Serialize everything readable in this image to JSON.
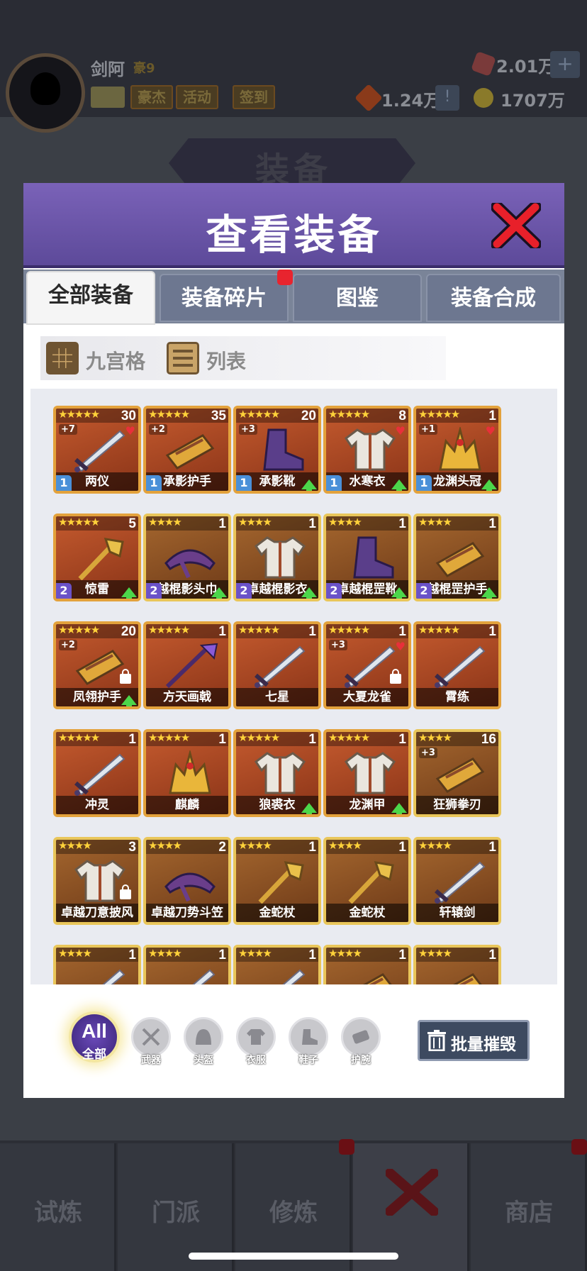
{
  "header": {
    "player_name": "剑阿",
    "player_rank": "豪9",
    "tags": [
      "豪杰",
      "活动",
      "签到"
    ],
    "currency_gems": "2.01万",
    "currency_tokens": "1.24万",
    "currency_coins": "1707万",
    "plus_label": "+",
    "excl_label": "!"
  },
  "page_title": "装备",
  "modal": {
    "title": "查看装备",
    "tabs": [
      "全部装备",
      "装备碎片",
      "图鉴",
      "装备合成"
    ],
    "view_grid_label": "九宫格",
    "view_list_label": "列表"
  },
  "items": [
    {
      "name": "两仪",
      "stars": 5,
      "count": "30",
      "plus": "+7",
      "heart": true,
      "tier": "1",
      "up": false,
      "lock": false,
      "art": "sword"
    },
    {
      "name": "承影护手",
      "stars": 5,
      "count": "35",
      "plus": "+2",
      "heart": false,
      "tier": "1",
      "up": false,
      "lock": false,
      "art": "bracer"
    },
    {
      "name": "承影靴",
      "stars": 5,
      "count": "20",
      "plus": "+3",
      "heart": false,
      "tier": "1",
      "up": true,
      "lock": false,
      "art": "boot"
    },
    {
      "name": "水寒衣",
      "stars": 5,
      "count": "8",
      "plus": "",
      "heart": true,
      "tier": "1",
      "up": true,
      "lock": false,
      "art": "armor"
    },
    {
      "name": "龙渊头冠",
      "stars": 5,
      "count": "1",
      "plus": "+1",
      "heart": true,
      "tier": "1",
      "up": true,
      "lock": false,
      "art": "crown"
    },
    {
      "name": "惊雷",
      "stars": 5,
      "count": "5",
      "plus": "",
      "heart": false,
      "tier": "2",
      "up": true,
      "lock": false,
      "art": "staff"
    },
    {
      "name": "越棍影头巾",
      "stars": 4,
      "count": "1",
      "plus": "",
      "heart": false,
      "tier": "2",
      "up": true,
      "lock": false,
      "art": "helm"
    },
    {
      "name": "卓越棍影衣",
      "stars": 4,
      "count": "1",
      "plus": "",
      "heart": false,
      "tier": "2",
      "up": true,
      "lock": false,
      "art": "armor"
    },
    {
      "name": "卓越棍罡靴",
      "stars": 4,
      "count": "1",
      "plus": "",
      "heart": false,
      "tier": "2",
      "up": true,
      "lock": false,
      "art": "boot"
    },
    {
      "name": "越棍罡护手",
      "stars": 4,
      "count": "1",
      "plus": "",
      "heart": false,
      "tier": "2",
      "up": true,
      "lock": false,
      "art": "bracer"
    },
    {
      "name": "凤翎护手",
      "stars": 5,
      "count": "20",
      "plus": "+2",
      "heart": false,
      "tier": "",
      "up": true,
      "lock": true,
      "art": "bracer"
    },
    {
      "name": "方天画戟",
      "stars": 5,
      "count": "1",
      "plus": "",
      "heart": false,
      "tier": "",
      "up": false,
      "lock": false,
      "art": "spear"
    },
    {
      "name": "七星",
      "stars": 5,
      "count": "1",
      "plus": "",
      "heart": false,
      "tier": "",
      "up": false,
      "lock": false,
      "art": "sword"
    },
    {
      "name": "大夏龙雀",
      "stars": 5,
      "count": "1",
      "plus": "+3",
      "heart": true,
      "tier": "",
      "up": false,
      "lock": true,
      "art": "sword"
    },
    {
      "name": "霄练",
      "stars": 5,
      "count": "1",
      "plus": "",
      "heart": false,
      "tier": "",
      "up": false,
      "lock": false,
      "art": "sword"
    },
    {
      "name": "冲灵",
      "stars": 5,
      "count": "1",
      "plus": "",
      "heart": false,
      "tier": "",
      "up": false,
      "lock": false,
      "art": "sword"
    },
    {
      "name": "麒麟",
      "stars": 5,
      "count": "1",
      "plus": "",
      "heart": false,
      "tier": "",
      "up": false,
      "lock": false,
      "art": "crown"
    },
    {
      "name": "狼裘衣",
      "stars": 5,
      "count": "1",
      "plus": "",
      "heart": false,
      "tier": "",
      "up": true,
      "lock": false,
      "art": "armor"
    },
    {
      "name": "龙渊甲",
      "stars": 5,
      "count": "1",
      "plus": "",
      "heart": false,
      "tier": "",
      "up": true,
      "lock": false,
      "art": "armor"
    },
    {
      "name": "狂狮拳刃",
      "stars": 4,
      "count": "16",
      "plus": "+3",
      "heart": false,
      "tier": "",
      "up": false,
      "lock": false,
      "art": "bracer"
    },
    {
      "name": "卓越刀意披风",
      "stars": 4,
      "count": "3",
      "plus": "",
      "heart": false,
      "tier": "",
      "up": false,
      "lock": true,
      "art": "armor"
    },
    {
      "name": "卓越刀势斗笠",
      "stars": 4,
      "count": "2",
      "plus": "",
      "heart": false,
      "tier": "",
      "up": false,
      "lock": false,
      "art": "helm"
    },
    {
      "name": "金蛇杖",
      "stars": 4,
      "count": "1",
      "plus": "",
      "heart": false,
      "tier": "",
      "up": false,
      "lock": false,
      "art": "staff"
    },
    {
      "name": "金蛇杖",
      "stars": 4,
      "count": "1",
      "plus": "",
      "heart": false,
      "tier": "",
      "up": false,
      "lock": false,
      "art": "staff"
    },
    {
      "name": "轩辕剑",
      "stars": 4,
      "count": "1",
      "plus": "",
      "heart": false,
      "tier": "",
      "up": false,
      "lock": false,
      "art": "sword"
    },
    {
      "name": "",
      "stars": 4,
      "count": "1",
      "plus": "",
      "heart": false,
      "tier": "",
      "up": false,
      "lock": false,
      "art": "sword"
    },
    {
      "name": "",
      "stars": 4,
      "count": "1",
      "plus": "",
      "heart": false,
      "tier": "",
      "up": false,
      "lock": false,
      "art": "sword"
    },
    {
      "name": "",
      "stars": 4,
      "count": "1",
      "plus": "",
      "heart": false,
      "tier": "",
      "up": false,
      "lock": false,
      "art": "sword"
    },
    {
      "name": "",
      "stars": 4,
      "count": "1",
      "plus": "",
      "heart": false,
      "tier": "",
      "up": false,
      "lock": false,
      "art": "bracer"
    },
    {
      "name": "",
      "stars": 4,
      "count": "1",
      "plus": "",
      "heart": false,
      "tier": "",
      "up": false,
      "lock": false,
      "art": "bracer"
    }
  ],
  "filters": {
    "all_label": "All",
    "all_sub": "全部",
    "categories": [
      "武器",
      "头盔",
      "衣服",
      "鞋子",
      "护腕"
    ],
    "batch_destroy": "批量摧毁"
  },
  "bottom_nav": [
    "试炼",
    "门派",
    "修炼",
    "",
    "商店"
  ],
  "colors": {
    "modal_header": "#6a54a8",
    "card_orange": "#c45a2e",
    "card_border": "#e3a23c",
    "tier1": "#4a90d8",
    "tier2": "#6a52c8",
    "upgrade_arrow": "#4cd64a"
  }
}
